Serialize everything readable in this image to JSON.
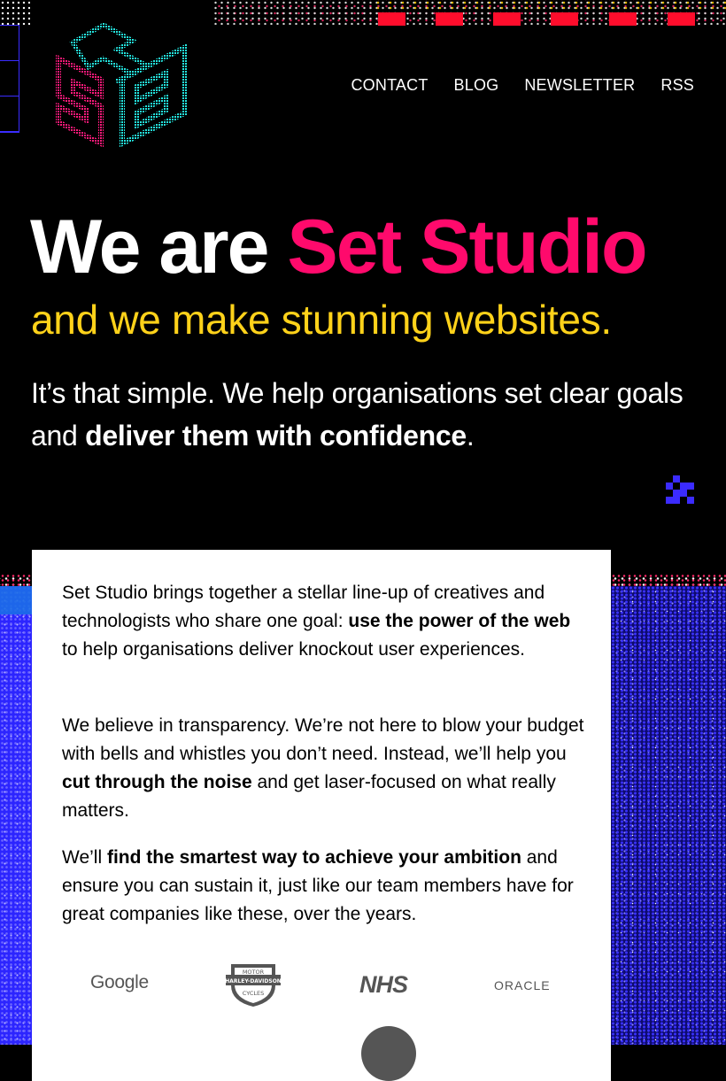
{
  "brand": {
    "logo_icon": "set-studio-logo",
    "accent_pink": "#ff0a6c",
    "accent_yellow": "#ffd21a",
    "accent_blue": "#2c25ff",
    "accent_cyan": "#1fe0dc"
  },
  "nav": {
    "items": [
      {
        "label": "CONTACT"
      },
      {
        "label": "BLOG"
      },
      {
        "label": "NEWSLETTER"
      },
      {
        "label": "RSS"
      }
    ]
  },
  "hero": {
    "title_plain": "We are ",
    "title_accent": "Set Studio",
    "subtitle": "and we make stunning websites.",
    "lead_part1": "It’s that simple. We help organisations set clear goals and ",
    "lead_bold": "deliver them with confidence",
    "lead_end": "."
  },
  "card": {
    "p1": {
      "t1": "Set Studio brings together a stellar line-up of creatives and technologists who share one goal: ",
      "b1": "use the power of the web",
      "t2": " to help organisations deliver knockout user experiences."
    },
    "p2": {
      "t1": "We believe in transparency. We’re not here to blow your budget with bells and whistles you don’t need. Instead, we’ll help you ",
      "b1": "cut through the noise",
      "t2": " and get laser-focused on what really matters."
    },
    "p3": {
      "t1": "We’ll ",
      "b1": "find the smartest way to achieve your ambition",
      "t2": " and ensure you can sustain it, just like our team members have for great companies like these, over the years."
    }
  },
  "clients": {
    "google": "Google",
    "nhs": "NHS",
    "oracle": "ORACLE",
    "harley": {
      "top": "MOTOR",
      "mid": "HARLEY-DAVIDSON",
      "bottom": "CYCLES"
    }
  }
}
